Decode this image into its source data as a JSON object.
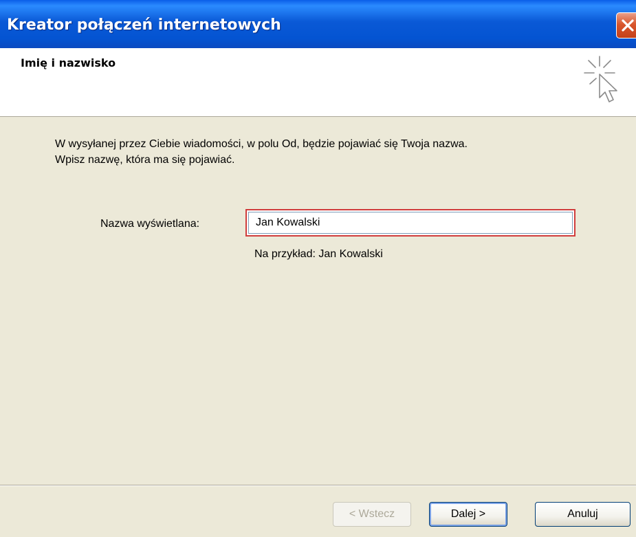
{
  "window": {
    "title": "Kreator połączeń internetowych"
  },
  "header": {
    "title": "Imię i nazwisko",
    "icon": "wizard-cursor-icon"
  },
  "body": {
    "instruction_line1": "W wysyłanej przez Ciebie wiadomości, w polu Od, będzie pojawiać się Twoja nazwa.",
    "instruction_line2": "Wpisz nazwę, która ma się pojawiać.",
    "display_name_label": "Nazwa wyświetlana:",
    "display_name_value": "Jan Kowalski",
    "example_text": "Na przykład: Jan Kowalski"
  },
  "buttons": {
    "back_label": "< Wstecz",
    "next_label": "Dalej >",
    "cancel_label": "Anuluj"
  },
  "colors": {
    "title_bar": "#0a59d6",
    "close_button": "#d9562c",
    "dialog_bg": "#ece9d8",
    "highlight_border": "#d03c3c"
  }
}
